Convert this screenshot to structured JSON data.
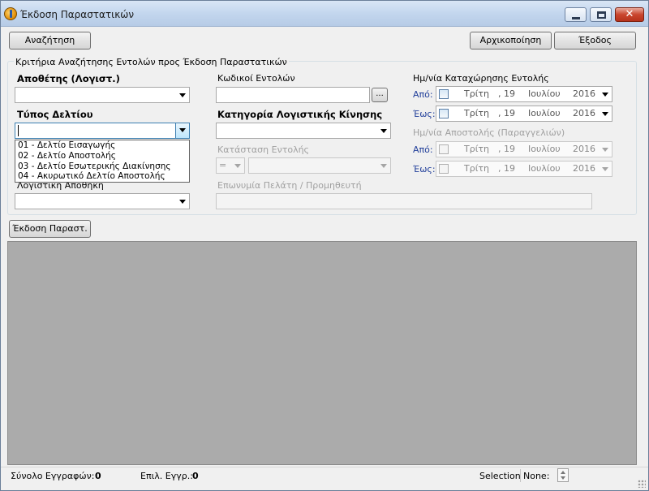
{
  "window": {
    "title": "Έκδοση Παραστατικών"
  },
  "toolbar": {
    "search_label": "Αναζήτηση",
    "reset_label": "Αρχικοποίηση",
    "exit_label": "Έξοδος"
  },
  "criteria": {
    "group_title": "Κριτήρια Αναζήτησης Εντολών προς Έκδοση Παραστατικών",
    "warehouse_label": "Αποθέτης (Λογιστ.)",
    "warehouse_value": "",
    "order_codes_label": "Κωδικοί Εντολών",
    "order_codes_value": "",
    "order_codes_button": "...",
    "doc_type_label": "Τύπος Δελτίου",
    "doc_type_value": "",
    "doc_type_options": [
      "01 - Δελτίο Εισαγωγής",
      "02 - Δελτίο Αποστολής",
      "03 - Δελτίο Εσωτερικής Διακίνησης",
      "04 - Ακυρωτικό Δελτίο Αποστολής"
    ],
    "movement_category_label": "Κατηγορία Λογιστικής Κίνησης",
    "movement_category_value": "",
    "logistic_warehouse_label": "Λογιστική Αποθήκη",
    "logistic_warehouse_value": "",
    "order_status_label": "Κατάσταση Εντολής",
    "order_status_operator": "=",
    "order_status_value": "",
    "customer_label": "Επωνυμία Πελάτη / Προμηθευτή",
    "customer_value": "",
    "registration_date": {
      "label": "Ημ/νία Καταχώρησης Εντολής",
      "from_label": "Από:",
      "to_label": "Έως:",
      "from": {
        "weekday": "Τρίτη",
        "day": ", 19",
        "month": "Ιουλίου",
        "year": "2016"
      },
      "to": {
        "weekday": "Τρίτη",
        "day": ", 19",
        "month": "Ιουλίου",
        "year": "2016"
      }
    },
    "shipping_date": {
      "label": "Ημ/νία Αποστολής (Παραγγελιών)",
      "from_label": "Από:",
      "to_label": "Έως:",
      "from": {
        "weekday": "Τρίτη",
        "day": ", 19",
        "month": "Ιουλίου",
        "year": "2016"
      },
      "to": {
        "weekday": "Τρίτη",
        "day": ", 19",
        "month": "Ιουλίου",
        "year": "2016"
      }
    }
  },
  "issue_button_label": "Έκδοση Παραστ.",
  "status": {
    "total_records_label": "Σύνολο Εγγραφών:",
    "total_records_value": "0",
    "selected_records_label": "Επιλ. Εγγρ.:",
    "selected_records_value": "0",
    "selection_label": "Selection",
    "selection_mode": "None:"
  }
}
